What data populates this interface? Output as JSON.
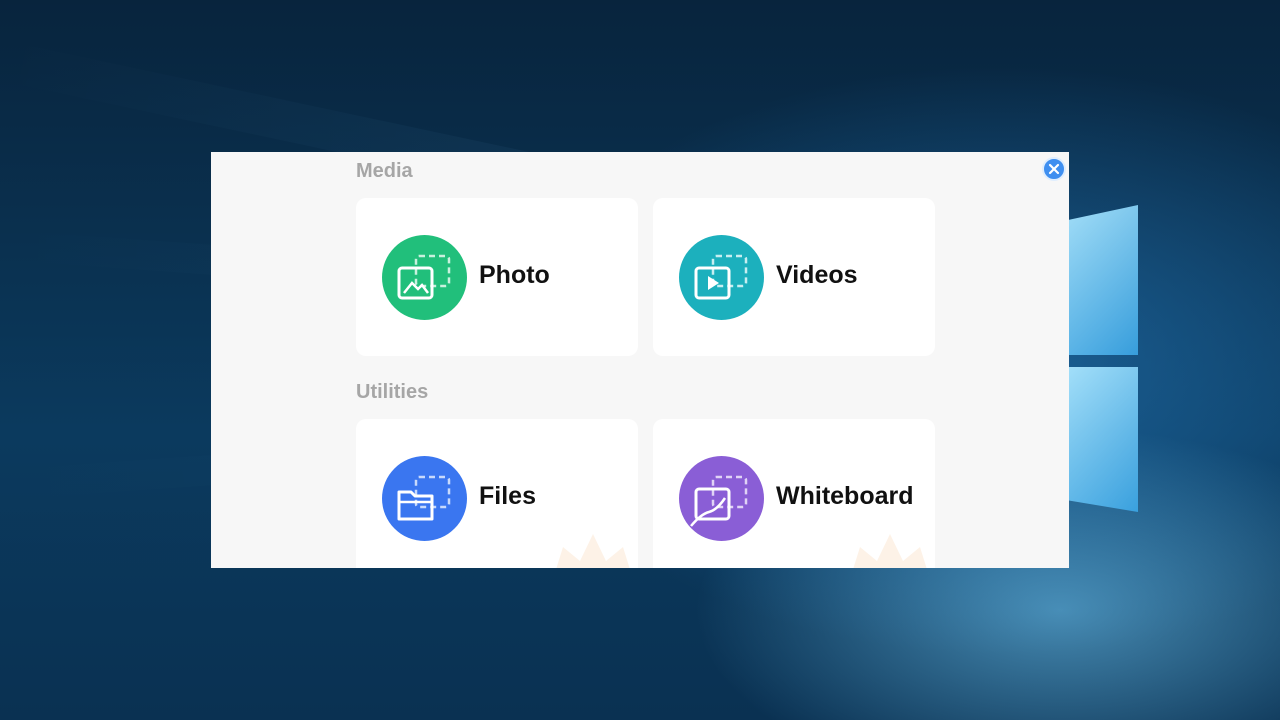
{
  "window": {
    "close_label": "close"
  },
  "sections": [
    {
      "title": "Media",
      "cards": [
        {
          "label": "Photo",
          "icon": "photo-icon",
          "color": "#21bf7b"
        },
        {
          "label": "Videos",
          "icon": "video-icon",
          "color": "#1cb0bd"
        }
      ]
    },
    {
      "title": "Utilities",
      "cards": [
        {
          "label": "Files",
          "icon": "folder-icon",
          "color": "#3a76f0"
        },
        {
          "label": "Whiteboard",
          "icon": "whiteboard-icon",
          "color": "#8a5ed6"
        }
      ]
    }
  ]
}
